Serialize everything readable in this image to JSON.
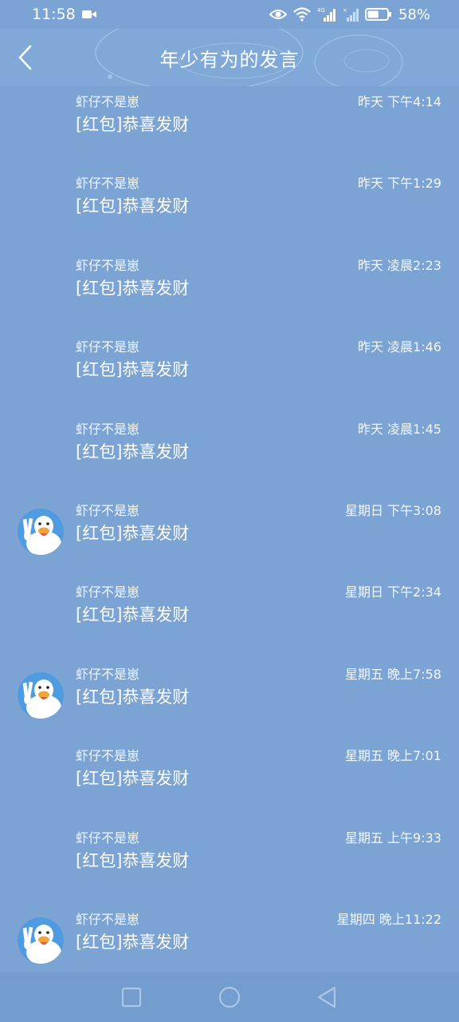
{
  "status_bar": {
    "time": "11:58",
    "battery_percent": "58%",
    "battery_level": 0.58,
    "icons": [
      "video-recording-icon",
      "eye-icon",
      "wifi-icon",
      "signal-4g-icon",
      "signal-no-sim-icon",
      "battery-icon"
    ]
  },
  "header": {
    "title": "年少有为的发言",
    "back_icon": "chevron-left-icon"
  },
  "messages": [
    {
      "sender": "虾仔不是崽",
      "time": "昨天 下午4:14",
      "text": "[红包]恭喜发财",
      "avatar": false
    },
    {
      "sender": "虾仔不是崽",
      "time": "昨天 下午1:29",
      "text": "[红包]恭喜发财",
      "avatar": false
    },
    {
      "sender": "虾仔不是崽",
      "time": "昨天 凌晨2:23",
      "text": "[红包]恭喜发财",
      "avatar": false
    },
    {
      "sender": "虾仔不是崽",
      "time": "昨天 凌晨1:46",
      "text": "[红包]恭喜发财",
      "avatar": false
    },
    {
      "sender": "虾仔不是崽",
      "time": "昨天 凌晨1:45",
      "text": "[红包]恭喜发财",
      "avatar": false
    },
    {
      "sender": "虾仔不是崽",
      "time": "星期日 下午3:08",
      "text": "[红包]恭喜发财",
      "avatar": true
    },
    {
      "sender": "虾仔不是崽",
      "time": "星期日 下午2:34",
      "text": "[红包]恭喜发财",
      "avatar": false
    },
    {
      "sender": "虾仔不是崽",
      "time": "星期五 晚上7:58",
      "text": "[红包]恭喜发财",
      "avatar": true
    },
    {
      "sender": "虾仔不是崽",
      "time": "星期五 晚上7:01",
      "text": "[红包]恭喜发财",
      "avatar": false
    },
    {
      "sender": "虾仔不是崽",
      "time": "星期五 上午9:33",
      "text": "[红包]恭喜发财",
      "avatar": false
    },
    {
      "sender": "虾仔不是崽",
      "time": "星期四 晚上11:22",
      "text": "[红包]恭喜发财",
      "avatar": true
    }
  ],
  "nav_bar": {
    "icons": [
      "recent-apps-icon",
      "home-icon",
      "back-icon"
    ]
  },
  "colors": {
    "background": "#7ba3d4",
    "header": "#80a9d8",
    "nav_bar": "#739dcf",
    "text": "#ffffff"
  }
}
